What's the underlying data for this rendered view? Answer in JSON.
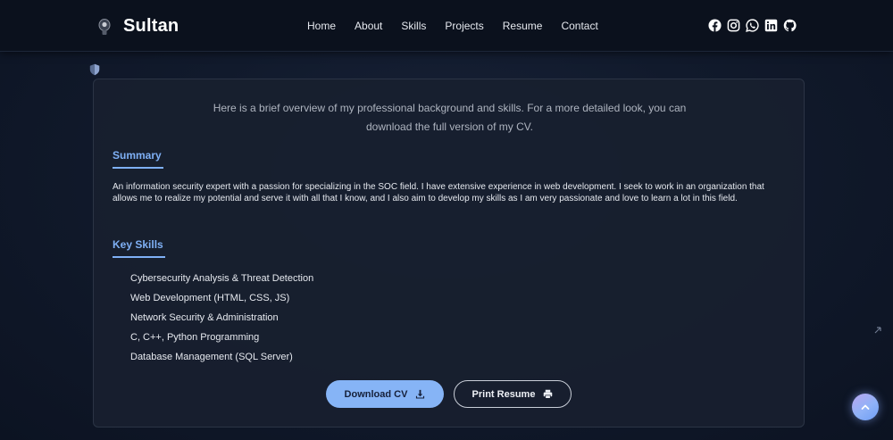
{
  "header": {
    "brand": "Sultan",
    "nav": [
      "Home",
      "About",
      "Skills",
      "Projects",
      "Resume",
      "Contact"
    ],
    "socials": [
      "facebook-icon",
      "instagram-icon",
      "whatsapp-icon",
      "linkedin-icon",
      "github-icon"
    ]
  },
  "resume": {
    "intro_line1": "Here is a brief overview of my professional background and skills. For a more detailed look, you can",
    "intro_line2": "download the full version of my CV.",
    "summary_title": "Summary",
    "summary_text": "An information security expert with a passion for specializing in the SOC field. I have extensive experience in web development. I seek to work in an organization that allows me to realize my potential and serve it with all that I know, and I also aim to develop my skills as I am very passionate and love to learn a lot in this field.",
    "skills_title": "Key Skills",
    "skills": [
      "Cybersecurity Analysis & Threat Detection",
      "Web Development (HTML, CSS, JS)",
      "Network Security & Administration",
      "C, C++, Python Programming",
      "Database Management (SQL Server)"
    ],
    "download_label": "Download CV",
    "print_label": "Print Resume"
  },
  "colors": {
    "accent": "#7fb0f5",
    "background": "#111a2c",
    "card": "#181f2f",
    "download_button": "#86b4f6"
  }
}
